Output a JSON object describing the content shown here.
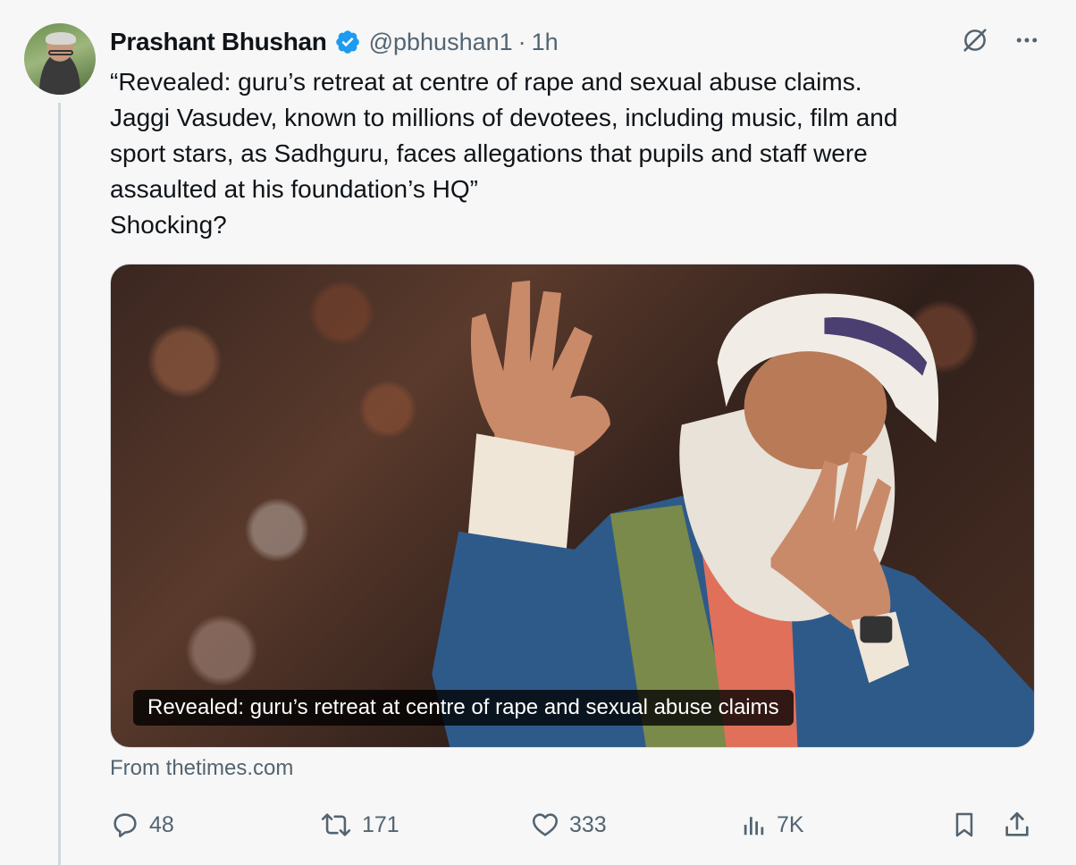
{
  "author": {
    "name": "Prashant Bhushan",
    "handle": "@pbhushan1",
    "separator": "·",
    "time": "1h",
    "verified": true
  },
  "tweet": {
    "lines": [
      "“Revealed: guru’s retreat at centre of rape and sexual abuse claims.",
      "Jaggi Vasudev, known to millions of devotees, including music, film and",
      "sport stars, as Sadhguru, faces allegations that pupils and staff were",
      "assaulted at his foundation’s HQ”",
      "Shocking?"
    ]
  },
  "card": {
    "caption": "Revealed: guru’s retreat at centre of rape and sexual abuse claims",
    "source": "From thetimes.com"
  },
  "actions": {
    "replies": "48",
    "reposts": "171",
    "likes": "333",
    "views": "7K"
  },
  "icons": {
    "verified": "verified-badge-icon",
    "grok": "grok-icon",
    "more": "more-icon",
    "reply": "reply-icon",
    "repost": "repost-icon",
    "like": "heart-icon",
    "views": "views-icon",
    "bookmark": "bookmark-icon",
    "share": "share-icon"
  },
  "colors": {
    "verified_blue": "#1d9bf0",
    "secondary_text": "#536471",
    "primary_text": "#0f1419",
    "background": "#f7f7f7"
  }
}
